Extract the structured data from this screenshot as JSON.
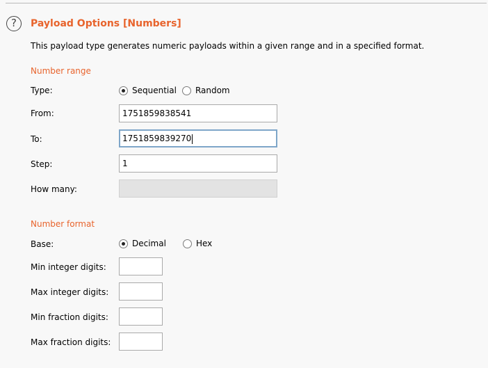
{
  "header": {
    "title": "Payload Options [Numbers]",
    "help_icon": "question-circle-icon",
    "description": "This payload type generates numeric payloads within a given range and in a specified format."
  },
  "number_range": {
    "section_label": "Number range",
    "type": {
      "label": "Type:",
      "options": [
        {
          "label": "Sequential",
          "selected": true
        },
        {
          "label": "Random",
          "selected": false
        }
      ]
    },
    "from": {
      "label": "From:",
      "value": "1751859838541"
    },
    "to": {
      "label": "To:",
      "value": "1751859839270"
    },
    "step": {
      "label": "Step:",
      "value": "1"
    },
    "how_many": {
      "label": "How many:",
      "value": ""
    }
  },
  "number_format": {
    "section_label": "Number format",
    "base": {
      "label": "Base:",
      "options": [
        {
          "label": "Decimal",
          "selected": true
        },
        {
          "label": "Hex",
          "selected": false
        }
      ]
    },
    "min_integer_digits": {
      "label": "Min integer digits:",
      "value": ""
    },
    "max_integer_digits": {
      "label": "Max integer digits:",
      "value": ""
    },
    "min_fraction_digits": {
      "label": "Min fraction digits:",
      "value": ""
    },
    "max_fraction_digits": {
      "label": "Max fraction digits:",
      "value": ""
    }
  },
  "colors": {
    "accent": "#e8642d",
    "focus_border": "#7ea6c9",
    "background": "#f8f8f8"
  }
}
